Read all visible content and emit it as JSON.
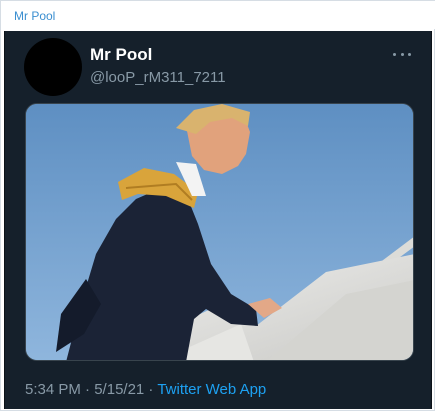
{
  "chat": {
    "sender_name": "Mr Pool"
  },
  "tweet": {
    "display_name": "Mr Pool",
    "handle": "@looP_rM311_7211",
    "more_icon": "more-horizontal-icon",
    "media_alt": "photo",
    "time": "5:34 PM",
    "separator": " · ",
    "date": "5/15/21",
    "source": "Twitter Web App"
  },
  "colors": {
    "card_background": "#15202b",
    "header_name": "#3a8ed0",
    "link": "#1da1f2",
    "secondary_text": "#8899a6"
  }
}
